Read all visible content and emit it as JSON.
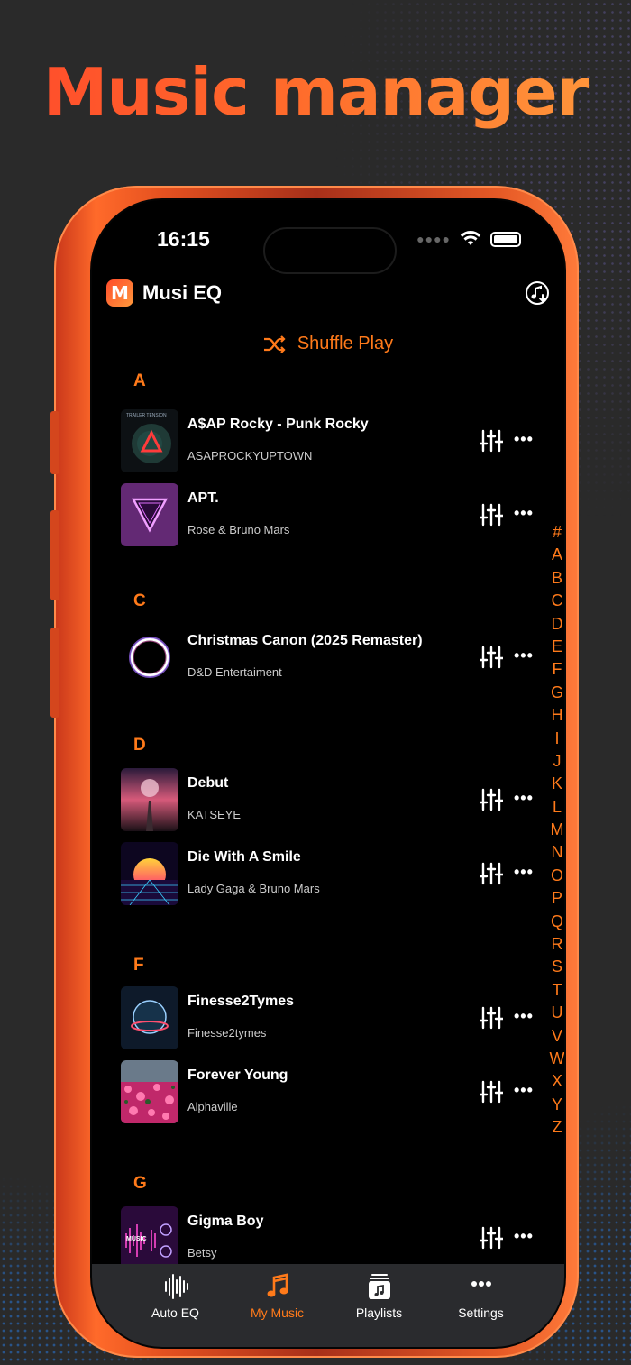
{
  "headline": "Music manager",
  "status_bar": {
    "time": "16:15"
  },
  "app": {
    "logo_letter": "M",
    "title": "Musi EQ"
  },
  "shuffle": {
    "label": "Shuffle Play"
  },
  "sections": [
    {
      "letter": "A",
      "songs": [
        {
          "title": "A$AP Rocky - Punk Rocky",
          "artist": "ASAPROCKYUPTOWN",
          "art": "trailer-tension-art"
        },
        {
          "title": "APT.",
          "artist": "Rose & Bruno Mars",
          "art": "neon-triangle-art"
        }
      ]
    },
    {
      "letter": "C",
      "songs": [
        {
          "title": "Christmas Canon (2025 Remaster)",
          "artist": "D&D Entertaiment",
          "art": "glowing-ring-art"
        }
      ]
    },
    {
      "letter": "D",
      "songs": [
        {
          "title": "Debut",
          "artist": "KATSEYE",
          "art": "pink-road-art"
        },
        {
          "title": "Die With A Smile",
          "artist": "Lady Gaga & Bruno Mars",
          "art": "synthwave-sun-art"
        }
      ]
    },
    {
      "letter": "F",
      "songs": [
        {
          "title": "Finesse2Tymes",
          "artist": "Finesse2tymes",
          "art": "planet-ring-art"
        },
        {
          "title": "Forever Young",
          "artist": "Alphaville",
          "art": "flower-field-art"
        }
      ]
    },
    {
      "letter": "G",
      "songs": [
        {
          "title": "Gigma Boy",
          "artist": "Betsy",
          "art": "music-wave-art"
        }
      ]
    }
  ],
  "alpha_index": [
    "#",
    "A",
    "B",
    "C",
    "D",
    "E",
    "F",
    "G",
    "H",
    "I",
    "J",
    "K",
    "L",
    "M",
    "N",
    "O",
    "P",
    "Q",
    "R",
    "S",
    "T",
    "U",
    "V",
    "W",
    "X",
    "Y",
    "Z"
  ],
  "tabs": [
    {
      "label": "Auto EQ",
      "icon": "waveform-icon",
      "active": false
    },
    {
      "label": "My Music",
      "icon": "music-note-icon",
      "active": true
    },
    {
      "label": "Playlists",
      "icon": "playlist-icon",
      "active": false
    },
    {
      "label": "Settings",
      "icon": "more-dots-icon",
      "active": false
    }
  ],
  "colors": {
    "accent": "#ff7a1a",
    "headline_start": "#ff4b2b",
    "headline_end": "#ff9a3c",
    "phone_frame": "#e65220",
    "tabbar": "#2a2b2e"
  }
}
